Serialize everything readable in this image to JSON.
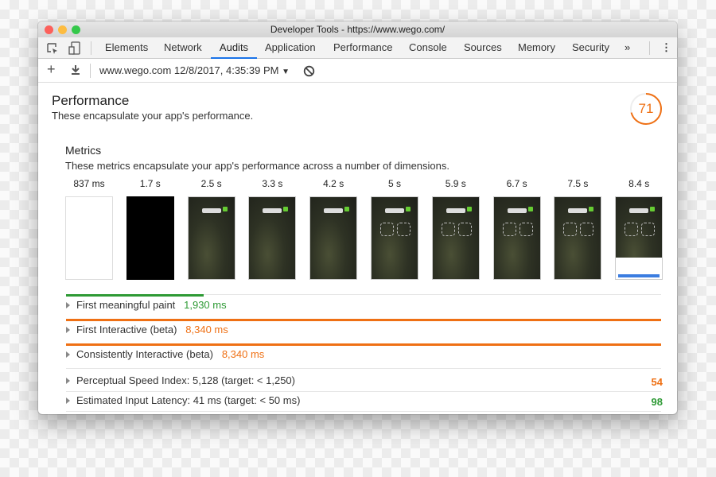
{
  "window": {
    "title": "Developer Tools - https://www.wego.com/"
  },
  "tabs": [
    {
      "label": "Elements"
    },
    {
      "label": "Network"
    },
    {
      "label": "Audits",
      "active": true
    },
    {
      "label": "Application"
    },
    {
      "label": "Performance"
    },
    {
      "label": "Console"
    },
    {
      "label": "Sources"
    },
    {
      "label": "Memory"
    },
    {
      "label": "Security"
    }
  ],
  "toolbar": {
    "report_select": "www.wego.com 12/8/2017, 4:35:39 PM"
  },
  "performance": {
    "title": "Performance",
    "description": "These encapsulate your app's performance.",
    "score": "71",
    "score_fraction": 0.71
  },
  "metrics": {
    "title": "Metrics",
    "description": "These metrics encapsulate your app's performance across a number of dimensions.",
    "filmstrip": [
      "837 ms",
      "1.7 s",
      "2.5 s",
      "3.3 s",
      "4.2 s",
      "5 s",
      "5.9 s",
      "6.7 s",
      "7.5 s",
      "8.4 s"
    ],
    "items": [
      {
        "label": "First meaningful paint",
        "value": "1,930 ms",
        "color": "#2e9a35"
      },
      {
        "label": "First Interactive (beta)",
        "value": "8,340 ms",
        "color": "#ef7014"
      },
      {
        "label": "Consistently Interactive (beta)",
        "value": "8,340 ms",
        "color": "#ef7014"
      }
    ]
  },
  "audits": [
    {
      "label": "Perceptual Speed Index: 5,128 (target: < 1,250)",
      "score": "54",
      "color": "#ef7014"
    },
    {
      "label": "Estimated Input Latency: 41 ms (target: < 50 ms)",
      "score": "98",
      "color": "#2e9a35"
    }
  ]
}
